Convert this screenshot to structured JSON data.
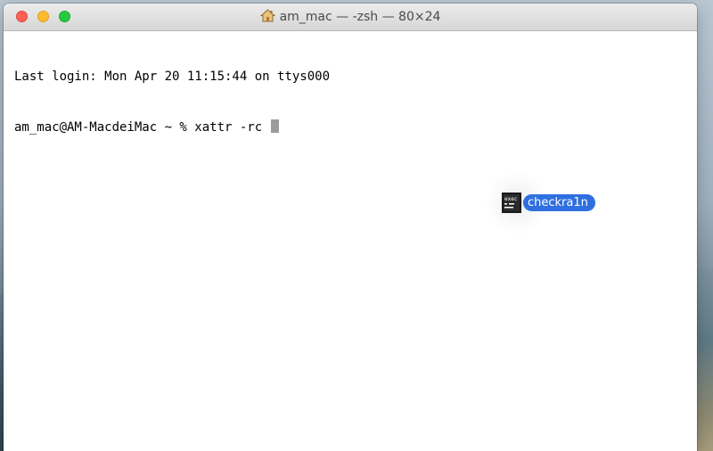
{
  "window": {
    "title": "am_mac — -zsh — 80×24",
    "title_icon": "home-icon",
    "traffic_lights": {
      "close_color": "#fe5f57",
      "minimize_color": "#febc2e",
      "zoom_color": "#28c840"
    }
  },
  "terminal": {
    "lines": [
      "Last login: Mon Apr 20 11:15:44 on ttys000",
      "am_mac@AM-MacdeiMac ~ % xattr -rc "
    ],
    "cursor_color": "#9c9c9c"
  },
  "drag": {
    "icon": "executable-file-icon",
    "label": "checkra1n",
    "label_color": "#2f6fe0"
  }
}
